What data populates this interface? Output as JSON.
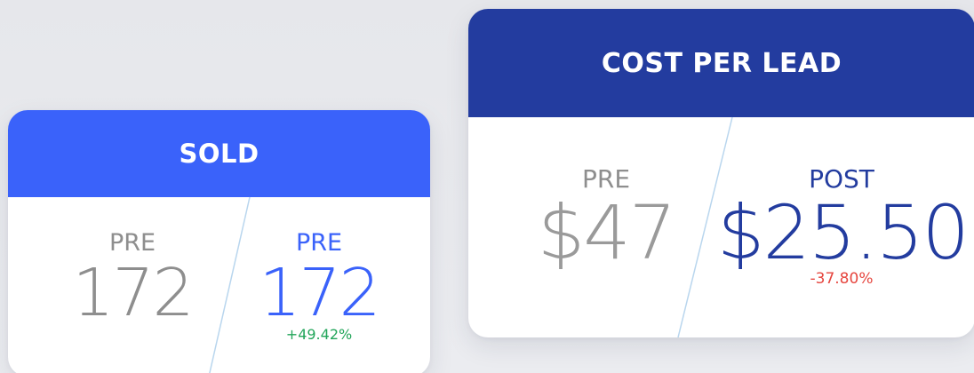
{
  "colors": {
    "sold_header": "#3a62fa",
    "cpl_header": "#233c9f",
    "pre_text": "#999999",
    "sold_post_text": "#3a62fa",
    "cpl_post_text": "#233c9f",
    "positive_delta": "#22a55a",
    "negative_delta": "#e6463f",
    "divider": "#b9d6ee"
  },
  "sold": {
    "title": "SOLD",
    "pre_label": "PRE",
    "pre_value": "172",
    "post_label": "PRE",
    "post_value": "172",
    "delta": "+49.42%"
  },
  "cost_per_lead": {
    "title": "COST PER LEAD",
    "pre_label": "PRE",
    "pre_value": "$47",
    "post_label": "POST",
    "post_value": "$25.50",
    "delta": "-37.80%"
  }
}
